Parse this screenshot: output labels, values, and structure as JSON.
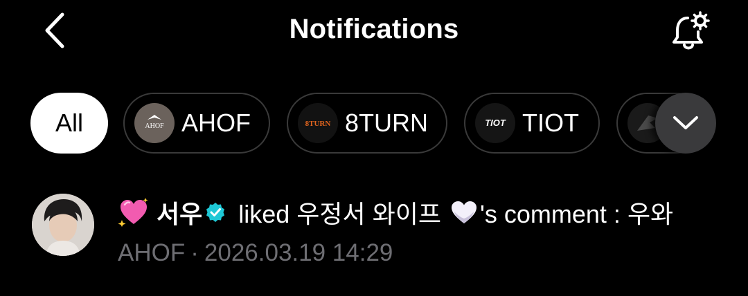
{
  "header": {
    "title": "Notifications",
    "back_icon": "chevron-left-icon",
    "settings_icon": "bell-settings-icon"
  },
  "filters": {
    "items": [
      {
        "label": "All",
        "selected": true
      },
      {
        "label": "AHOF",
        "logo_text": "AHOF"
      },
      {
        "label": "8TURN",
        "logo_text": "8TURN"
      },
      {
        "label": "TIOT",
        "logo_text": "TIOT"
      },
      {
        "label": "",
        "logo_text": ""
      }
    ],
    "expand_icon": "chevron-down-icon"
  },
  "notification": {
    "username": "서우",
    "text_before": "liked 우정서 와이프",
    "text_after": "'s comment : 우와",
    "group": "AHOF",
    "separator": "·",
    "timestamp": "2026.03.19 14:29"
  },
  "colors": {
    "background": "#000000",
    "chip_border": "#3a3a3a",
    "meta_text": "#6e6e73",
    "verified": "#1ec8d6"
  }
}
